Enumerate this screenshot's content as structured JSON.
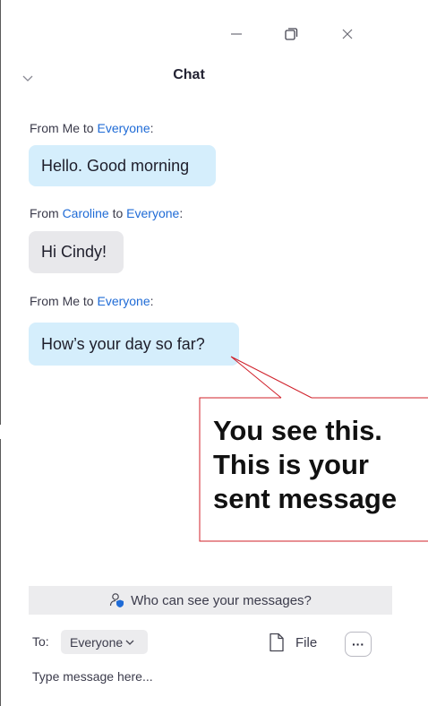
{
  "window": {
    "title": "Chat"
  },
  "messages": [
    {
      "sender": "Me",
      "recipient": "Everyone",
      "from_prefix": "From",
      "to_word": "to",
      "suffix": ":",
      "text": "Hello. Good morning",
      "kind": "sent"
    },
    {
      "sender": "Caroline",
      "recipient": "Everyone",
      "from_prefix": "From",
      "to_word": "to",
      "suffix": ":",
      "text": "Hi Cindy!",
      "kind": "received"
    },
    {
      "sender": "Me",
      "recipient": "Everyone",
      "from_prefix": "From",
      "to_word": "to",
      "suffix": ":",
      "text": "How’s your day so far?",
      "kind": "sent"
    }
  ],
  "callout": {
    "line1": "You see this.",
    "line2": "This is your",
    "line3": "sent message"
  },
  "composer": {
    "visibility_prompt": "Who can see your messages?",
    "to_label": "To:",
    "recipient": "Everyone",
    "file_label": "File",
    "more_label": "···",
    "placeholder": "Type message here..."
  },
  "colors": {
    "link": "#1f6bd6",
    "sent_bubble": "#d5eefc",
    "received_bubble": "#e8e8eb",
    "callout_border": "#d0202a"
  }
}
